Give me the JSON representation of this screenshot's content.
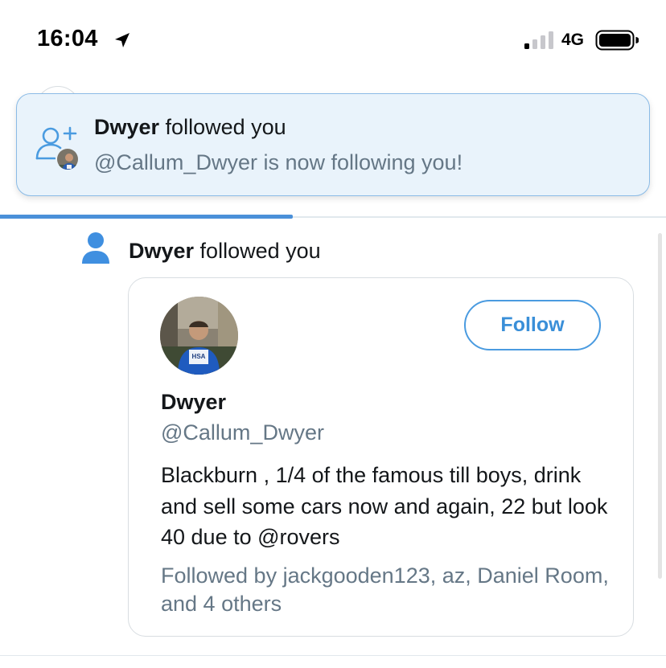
{
  "status_bar": {
    "time": "16:04",
    "network": "4G",
    "icons": [
      "location-arrow-icon",
      "signal-bars-icon",
      "battery-icon"
    ]
  },
  "toast": {
    "name": "Dwyer",
    "action": " followed you",
    "message": "@Callum_Dwyer is now following you!",
    "icon": "follow-user-icon"
  },
  "progress": {
    "fraction": 0.44
  },
  "notification": {
    "icon": "person-icon",
    "name": "Dwyer",
    "action": " followed you"
  },
  "profile_card": {
    "name": "Dwyer",
    "handle": "@Callum_Dwyer",
    "follow_label": "Follow",
    "bio": "Blackburn , 1/4 of the famous till boys, drink and sell some cars now and again, 22 but look 40 due to @rovers",
    "followed_by": "Followed by jackgooden123, az, Daniel Room, and 4 others"
  },
  "colors": {
    "accent": "#4a9be0",
    "toast_bg": "#e9f3fb",
    "toast_border": "#8bbbe6",
    "secondary_text": "#657786",
    "progress": "#4a90d9"
  }
}
